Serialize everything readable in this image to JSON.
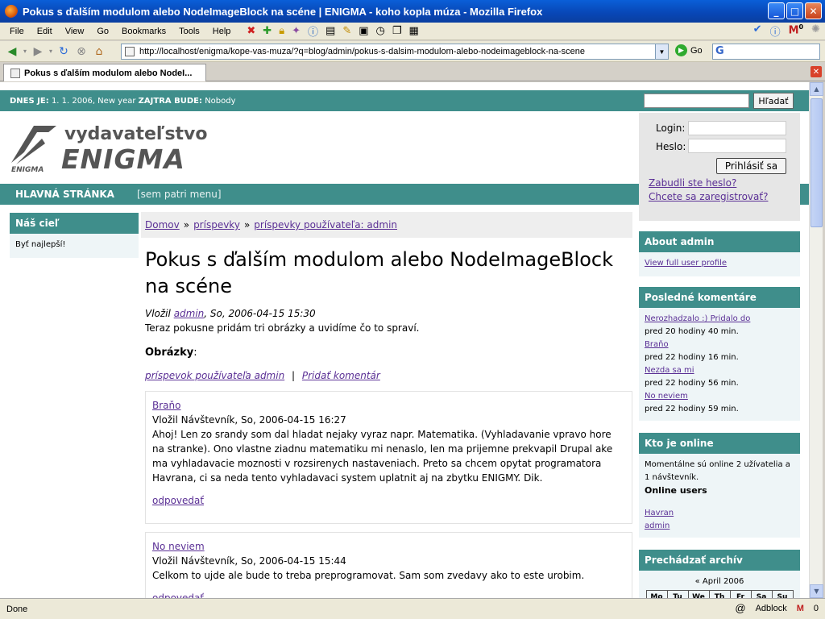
{
  "window": {
    "title": "Pokus s ďalším modulom alebo NodeImageBlock na scéne | ENIGMA - koho kopla múza - Mozilla Firefox"
  },
  "menubar": {
    "items": [
      "File",
      "Edit",
      "View",
      "Go",
      "Bookmarks",
      "Tools",
      "Help"
    ],
    "mail_count": "0"
  },
  "navbar": {
    "url": "http://localhost/enigma/kope-vas-muza/?q=blog/admin/pokus-s-dalsim-modulom-alebo-nodeimageblock-na-scene",
    "go_label": "Go",
    "search_value": ""
  },
  "tab": {
    "label": "Pokus s ďalším modulom alebo NodeI..."
  },
  "site": {
    "date_label": "DNES JE:",
    "date_value": "1. 1. 2006, New year",
    "tomorrow_label": "ZAJTRA BUDE:",
    "tomorrow_value": "Nobody",
    "search_button": "Hľadať",
    "logo_top": "vydavateľstvo",
    "logo_main": "ENIGMA",
    "logo_small": "ENIGMA",
    "nav_home": "HLAVNÁ STRÁNKA",
    "nav_rest": "[sem patri menu]"
  },
  "login": {
    "login_label": "Login:",
    "password_label": "Heslo:",
    "submit": "Prihlásiť sa",
    "forgot": "Zabudli ste heslo?",
    "register": "Chcete sa zaregistrovať?"
  },
  "left_block": {
    "title": "Náš cieľ",
    "body": "Byť najlepší!"
  },
  "breadcrumb": {
    "items": [
      "Domov",
      "príspevky",
      "príspevky používateľa: admin"
    ],
    "sep": "»"
  },
  "node": {
    "title": "Pokus s ďalším modulom alebo NodeImageBlock na scéne",
    "meta_prefix": "Vložil",
    "meta_author": "admin",
    "meta_date": ", So, 2006-04-15 15:30",
    "body": "Teraz pokusne pridám tri obrázky a uvidíme čo to spraví.",
    "images_label": "Obrázky",
    "images_colon": ":",
    "link_user": "príspevok používateľa admin",
    "link_sep": "|",
    "link_comment": "Pridať komentár"
  },
  "comments": [
    {
      "title": "Braňo",
      "meta": "Vložil Návštevník, So, 2006-04-15 16:27",
      "body": "Ahoj! Len zo srandy som dal hladat nejaky vyraz napr. Matematika. (Vyhladavanie vpravo hore na stranke). Ono vlastne ziadnu matematiku mi nenaslo, len ma prijemne prekvapil Drupal ake ma vyhladavacie moznosti v rozsirenych nastaveniach. Preto sa chcem opytat programatora Havrana, ci sa neda tento vyhladavaci system uplatnit aj na zbytku ENIGMY. Dik.",
      "reply": "odpovedať"
    },
    {
      "title": "No neviem",
      "meta": "Vložil Návštevník, So, 2006-04-15 15:44",
      "body": "Celkom to ujde ale bude to treba preprogramovat. Sam som zvedavy ako to este urobim.",
      "reply": "odpovedať"
    }
  ],
  "right": {
    "about_title": "About admin",
    "about_link": "View full user profile",
    "comments_title": "Posledné komentáre",
    "recent": [
      {
        "title": "Nerozhadzalo :) Pridalo do",
        "time": "pred 20 hodiny 40 min."
      },
      {
        "title": "Braňo",
        "time": "pred 22 hodiny 16 min."
      },
      {
        "title": "Nezda sa mi",
        "time": "pred 22 hodiny 56 min."
      },
      {
        "title": "No neviem",
        "time": "pred 22 hodiny 59 min."
      }
    ],
    "online_title": "Kto je online",
    "online_text": "Momentálne sú online 2 užívatelia a 1 návštevník.",
    "online_users_label": "Online users",
    "online_users": [
      "Havran",
      "admin"
    ],
    "archive_title": "Prechádzať archív",
    "archive_month": "« April 2006",
    "weekdays": [
      "Mo",
      "Tu",
      "We",
      "Th",
      "Fr",
      "Sa",
      "Su"
    ]
  },
  "status": {
    "text": "Done",
    "adblock": "Adblock",
    "mail": "0"
  }
}
